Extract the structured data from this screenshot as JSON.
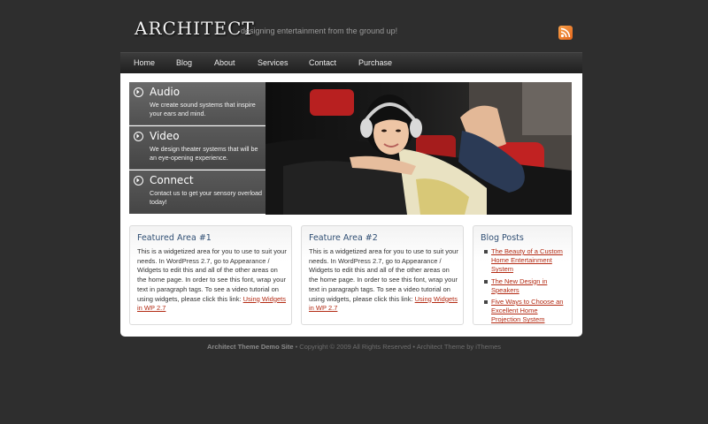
{
  "header": {
    "logo": "ARCHITECT",
    "tagline": "designing entertainment from the ground up!",
    "rss_icon": "rss-feed-icon"
  },
  "nav": {
    "items": [
      "Home",
      "Blog",
      "About",
      "Services",
      "Contact",
      "Purchase"
    ]
  },
  "features": {
    "tabs": [
      {
        "title": "Audio",
        "desc": "We create sound systems that inspire your ears and mind."
      },
      {
        "title": "Video",
        "desc": "We design theater systems that will be an eye-opening experience."
      },
      {
        "title": "Connect",
        "desc": "Contact us to get your sensory overload today!"
      }
    ],
    "tab_icon": "circle-arrow-right-icon",
    "photo": "woman with headphones lying on a leather sofa"
  },
  "widgets": {
    "area1": {
      "title": "Featured Area #1",
      "body": "This is a widgetized area for you to use to suit your needs. In WordPress 2.7, go to Appearance / Widgets to edit this and all of the other areas on the home page. In order to see this font, wrap your text in paragraph tags. To see a video tutorial on using widgets, please click this link: ",
      "link": "Using Widgets in WP 2.7"
    },
    "area2": {
      "title": "Feature Area #2",
      "body": "This is a widgetized area for you to use to suit your needs. In WordPress 2.7, go to Appearance / Widgets to edit this and all of the other areas on the home page. In order to see this font, wrap your text in paragraph tags. To see a video tutorial on using widgets, please click this link: ",
      "link": "Using Widgets in WP 2.7"
    },
    "blog": {
      "title": "Blog Posts",
      "posts": [
        "The Beauty of a Custom Home Entertainment System",
        "The New Design in Speakers",
        "Five Ways to Choose an Excellent Home Projection System"
      ]
    }
  },
  "footer": {
    "site": "Architect Theme Demo Site",
    "rest": " • Copyright © 2009 All Rights Reserved • Architect Theme by iThemes"
  },
  "colors": {
    "background": "#2e2e2e",
    "link": "#b32a13",
    "widget_title": "#2f4e73"
  }
}
